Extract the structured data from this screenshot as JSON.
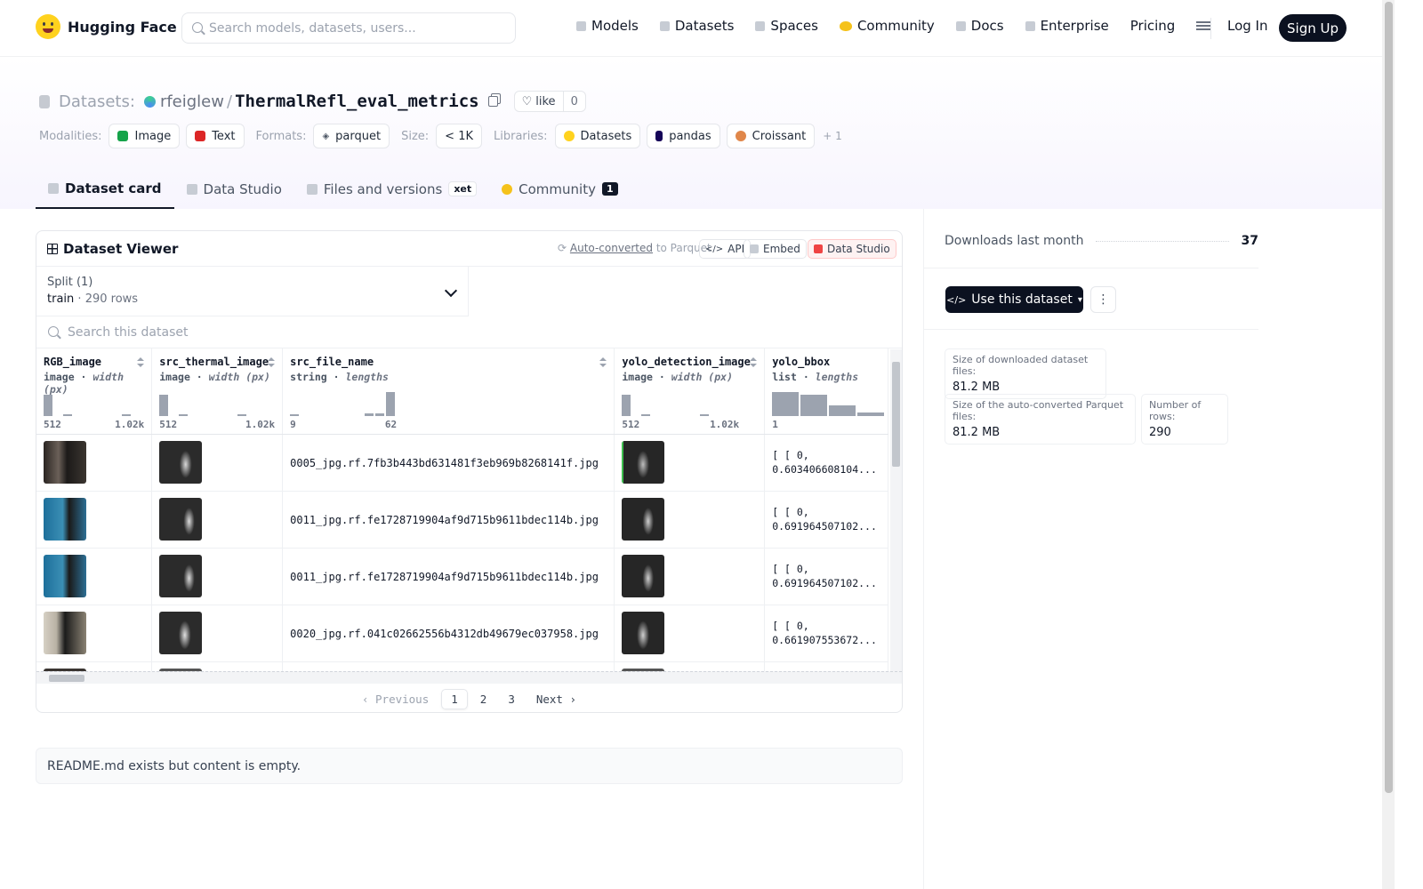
{
  "nav": {
    "brand": "Hugging Face",
    "search_placeholder": "Search models, datasets, users...",
    "menu": [
      {
        "label": "Models",
        "icon": "cube-icon"
      },
      {
        "label": "Datasets",
        "icon": "database-icon"
      },
      {
        "label": "Spaces",
        "icon": "grid-icon"
      },
      {
        "label": "Community",
        "icon": "community-icon"
      },
      {
        "label": "Docs",
        "icon": "book-icon"
      },
      {
        "label": "Enterprise",
        "icon": "enterprise-icon"
      },
      {
        "label": "Pricing"
      }
    ],
    "login": "Log In",
    "signup": "Sign Up"
  },
  "repo": {
    "type_label": "Datasets:",
    "owner": "rfeiglew",
    "name": "ThermalRefl_eval_metrics",
    "like_label": "like",
    "like_count": "0"
  },
  "tags": {
    "modalities_label": "Modalities:",
    "modalities": [
      "Image",
      "Text"
    ],
    "formats_label": "Formats:",
    "formats": [
      "parquet"
    ],
    "size_label": "Size:",
    "size": "< 1K",
    "libraries_label": "Libraries:",
    "libraries": [
      "Datasets",
      "pandas",
      "Croissant"
    ],
    "more": "+ 1"
  },
  "tabs": [
    {
      "label": "Dataset card",
      "active": true
    },
    {
      "label": "Data Studio"
    },
    {
      "label": "Files and versions",
      "badge": "xet"
    },
    {
      "label": "Community",
      "count": "1"
    }
  ],
  "viewer": {
    "title": "Dataset Viewer",
    "auto_converted": "Auto-converted",
    "to_parquet": "to Parquet",
    "api": "API",
    "embed": "Embed",
    "data_studio": "Data Studio",
    "split_label": "Split (1)",
    "split_name": "train",
    "split_rows": "290 rows",
    "search_placeholder": "Search this dataset",
    "columns": [
      {
        "name": "RGB_image",
        "type": "image",
        "sub": "width (px)",
        "min": "512",
        "max": "1.02k",
        "hist": [
          0.85,
          0.05,
          0,
          0,
          0.04
        ]
      },
      {
        "name": "src_thermal_image",
        "type": "image",
        "sub": "width (px)",
        "min": "512",
        "max": "1.02k",
        "hist": [
          0.85,
          0.05,
          0,
          0,
          0.04
        ]
      },
      {
        "name": "src_file_name",
        "type": "string",
        "sub": "lengths",
        "min": "9",
        "max": "62",
        "hist": [
          0.05,
          0,
          0,
          0,
          0,
          0,
          0,
          0.12,
          0.1,
          0.95
        ]
      },
      {
        "name": "yolo_detection_image",
        "type": "image",
        "sub": "width (px)",
        "min": "512",
        "max": "1.02k",
        "hist": [
          0.85,
          0.05,
          0,
          0,
          0.04
        ]
      },
      {
        "name": "yolo_bbox",
        "type": "list",
        "sub": "lengths",
        "min": "1",
        "max": "",
        "hist": [
          0.95,
          0.85,
          0.42,
          0.15
        ]
      }
    ],
    "rows": [
      {
        "file": "0005_jpg.rf.7fb3b443bd631481f3eb969b8268141f.jpg",
        "bbox1": "[ [ 0,",
        "bbox2": "0.603406608104..."
      },
      {
        "file": "0011_jpg.rf.fe1728719904af9d715b9611bdec114b.jpg",
        "bbox1": "[ [ 0,",
        "bbox2": "0.691964507102..."
      },
      {
        "file": "0011_jpg.rf.fe1728719904af9d715b9611bdec114b.jpg",
        "bbox1": "[ [ 0,",
        "bbox2": "0.691964507102..."
      },
      {
        "file": "0020_jpg.rf.041c02662556b4312db49679ec037958.jpg",
        "bbox1": "[ [ 0,",
        "bbox2": "0.661907553672..."
      }
    ],
    "pager": {
      "previous": "Previous",
      "pages": [
        "1",
        "2",
        "3"
      ],
      "current": "1",
      "next": "Next"
    }
  },
  "readme": "README.md exists but content is empty.",
  "sidebar": {
    "downloads_label": "Downloads last month",
    "downloads": "37",
    "use_button": "Use this dataset",
    "stats": [
      {
        "label": "Size of downloaded dataset files:",
        "value": "81.2 MB"
      },
      {
        "label": "Size of the auto-converted Parquet files:",
        "value": "81.2 MB"
      },
      {
        "label": "Number of rows:",
        "value": "290"
      }
    ]
  },
  "colors": {
    "accent_dark": "#0b1120",
    "brand_yellow": "#ffd21e"
  }
}
